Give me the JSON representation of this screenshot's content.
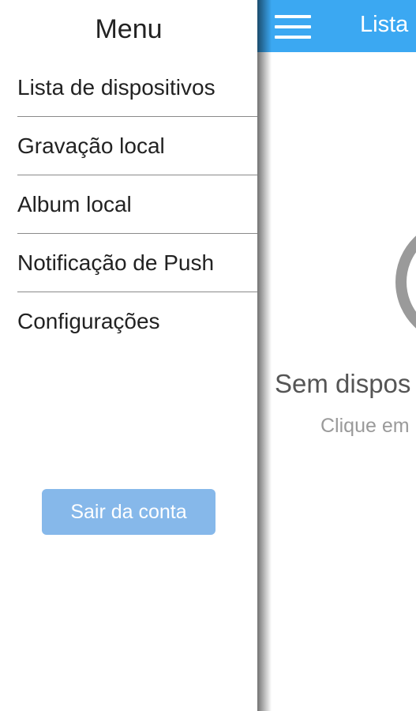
{
  "drawer": {
    "title": "Menu",
    "items": [
      {
        "label": "Lista de dispositivos"
      },
      {
        "label": "Gravação local"
      },
      {
        "label": "Album local"
      },
      {
        "label": "Notificação de Push"
      },
      {
        "label": "Configurações"
      }
    ],
    "logout_label": "Sair da conta"
  },
  "main": {
    "appbar_title": "Lista",
    "empty_title": "Sem dispos",
    "empty_subtitle": "Clique em"
  },
  "colors": {
    "appbar": "#3ba8f2",
    "logout_button": "#86b8ea",
    "divider": "#8a8a8a"
  },
  "icons": {
    "menu": "hamburger-menu-icon",
    "empty_state": "empty-device-icon"
  }
}
